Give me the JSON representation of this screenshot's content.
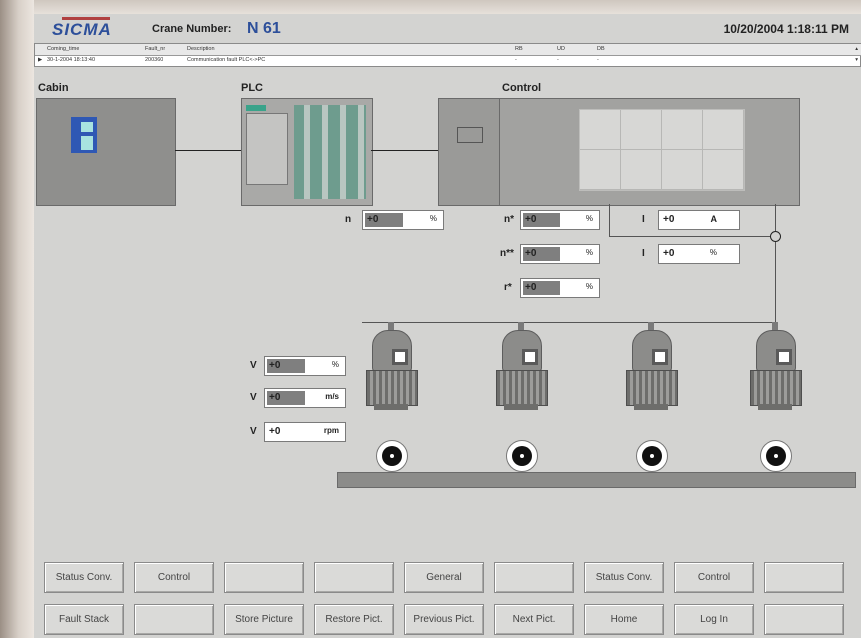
{
  "header": {
    "logo": "SICMA",
    "crane_label": "Crane Number:",
    "crane_number": "N  61",
    "datetime": "10/20/2004 1:18:11 PM"
  },
  "fault_table": {
    "headers": [
      "Coming_time",
      "Fault_nr",
      "Description",
      "RB",
      "UD",
      "DB"
    ],
    "row": [
      "30-1-2004 18:13:40",
      "200360",
      "Communication fault PLC<->PC",
      "-",
      "-",
      "-"
    ]
  },
  "sections": {
    "cabin": "Cabin",
    "plc": "PLC",
    "control": "Control"
  },
  "fields": {
    "n": {
      "label": "n",
      "value": "+0",
      "unit": "%",
      "level": 0.5
    },
    "n_star": {
      "label": "n*",
      "value": "+0",
      "unit": "%",
      "level": 0.5
    },
    "n_2star": {
      "label": "n**",
      "value": "+0",
      "unit": "%",
      "level": 0.5
    },
    "r_star": {
      "label": "r*",
      "value": "+0",
      "unit": "%",
      "level": 0.5
    },
    "i_a": {
      "label": "I",
      "value": "+0",
      "unit": "A",
      "level": 0
    },
    "i_pct": {
      "label": "I",
      "value": "+0",
      "unit": "%",
      "level": 0
    },
    "v_pct": {
      "label": "V",
      "value": "+0",
      "unit": "%",
      "level": 0.5
    },
    "v_ms": {
      "label": "V",
      "value": "+0",
      "unit": "m/s",
      "level": 0.5
    },
    "v_rpm": {
      "label": "V",
      "value": "+0",
      "unit": "rpm",
      "level": 0
    }
  },
  "buttons_row1": [
    "Status Conv.",
    "Control",
    "",
    "",
    "General",
    "",
    "Status Conv.",
    "Control",
    ""
  ],
  "buttons_row2": [
    "Fault Stack",
    "",
    "Store Picture",
    "Restore Pict.",
    "Previous Pict.",
    "Next Pict.",
    "Home",
    "Log In",
    ""
  ]
}
